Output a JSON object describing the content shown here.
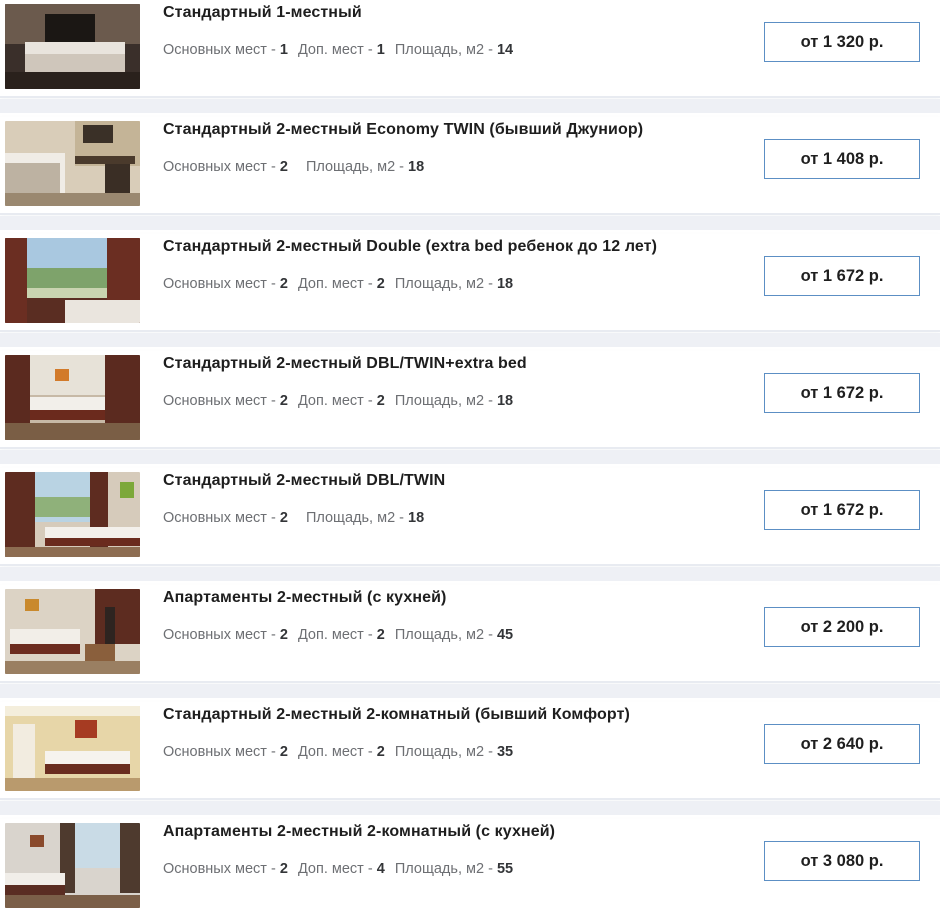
{
  "labels": {
    "main_places": "Основных мест - ",
    "extra_places": "Доп. мест - ",
    "area": "Площадь, м2 - "
  },
  "rooms": [
    {
      "title": "Стандартный 1-местный",
      "main": "1",
      "extra": "1",
      "area": "14",
      "price": "от 1 320 р."
    },
    {
      "title": "Стандартный 2-местный Economy TWIN (бывший Джуниор)",
      "main": "2",
      "extra": null,
      "area": "18",
      "price": "от 1 408 р."
    },
    {
      "title": "Стандартный 2-местный Double (extra bed ребенок до 12 лет)",
      "main": "2",
      "extra": "2",
      "area": "18",
      "price": "от 1 672 р."
    },
    {
      "title": "Стандартный 2-местный DBL/TWIN+extra bed",
      "main": "2",
      "extra": "2",
      "area": "18",
      "price": "от 1 672 р."
    },
    {
      "title": "Стандартный 2-местный DBL/TWIN",
      "main": "2",
      "extra": null,
      "area": "18",
      "price": "от 1 672 р."
    },
    {
      "title": "Апартаменты 2-местный (с кухней)",
      "main": "2",
      "extra": "2",
      "area": "45",
      "price": "от 2 200 р."
    },
    {
      "title": "Стандартный 2-местный 2-комнатный (бывший Комфорт)",
      "main": "2",
      "extra": "2",
      "area": "35",
      "price": "от 2 640 р."
    },
    {
      "title": "Апартаменты 2-местный 2-комнатный (с кухней)",
      "main": "2",
      "extra": "4",
      "area": "55",
      "price": "от 3 080 р."
    }
  ],
  "colors": {
    "price_border": "#5c8fc4",
    "separator": "#eef0f5",
    "spec_label": "#6d6f73"
  }
}
